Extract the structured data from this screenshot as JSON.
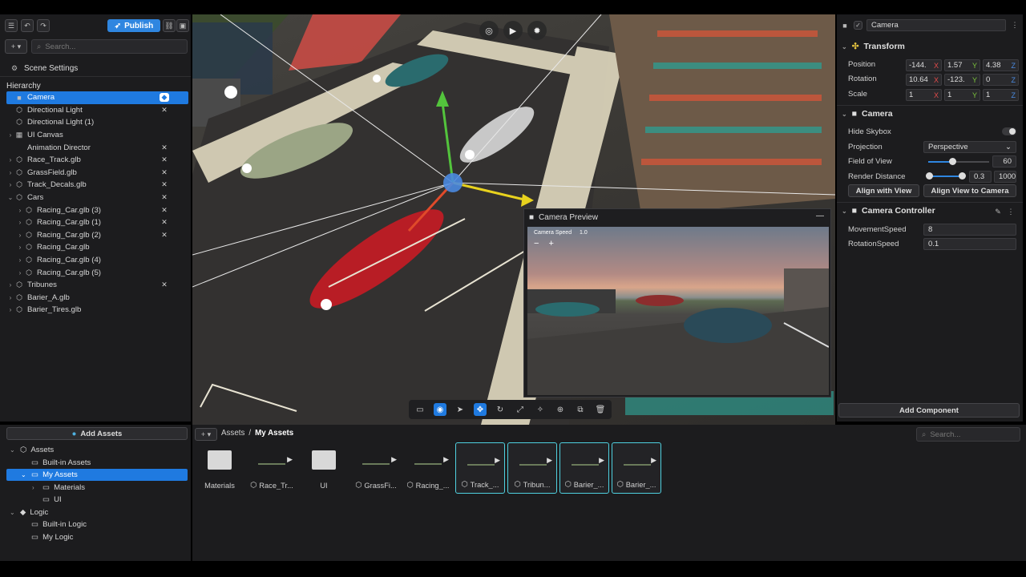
{
  "toolbar": {
    "publish_label": "Publish",
    "search_placeholder": "Search..."
  },
  "scene_settings_label": "Scene Settings",
  "hierarchy": {
    "title": "Hierarchy",
    "items": [
      {
        "label": "Camera",
        "icon": "camera-icon",
        "arrow": "",
        "indent": 0,
        "selected": true,
        "badge": "logic-icon"
      },
      {
        "label": "Directional Light",
        "icon": "cube-icon",
        "arrow": "",
        "indent": 0,
        "badge": "animation-icon"
      },
      {
        "label": "Directional Light (1)",
        "icon": "cube-icon",
        "arrow": "",
        "indent": 0,
        "badge": ""
      },
      {
        "label": "UI Canvas",
        "icon": "grid-icon",
        "arrow": "›",
        "indent": 0,
        "badge": ""
      },
      {
        "label": "Animation Director",
        "icon": "",
        "arrow": "",
        "indent": 0,
        "badge": "animation-icon"
      },
      {
        "label": "Race_Track.glb",
        "icon": "cube-icon",
        "arrow": "›",
        "indent": 0,
        "badge": "animation-icon"
      },
      {
        "label": "GrassField.glb",
        "icon": "cube-icon",
        "arrow": "›",
        "indent": 0,
        "badge": "animation-icon"
      },
      {
        "label": "Track_Decals.glb",
        "icon": "cube-icon",
        "arrow": "›",
        "indent": 0,
        "badge": "animation-icon"
      },
      {
        "label": "Cars",
        "icon": "cube-icon",
        "arrow": "⌄",
        "indent": 0,
        "badge": "animation-icon"
      },
      {
        "label": "Racing_Car.glb (3)",
        "icon": "cube-icon",
        "arrow": "›",
        "indent": 1,
        "badge": "animation-icon"
      },
      {
        "label": "Racing_Car.glb (1)",
        "icon": "cube-icon",
        "arrow": "›",
        "indent": 1,
        "badge": "animation-icon"
      },
      {
        "label": "Racing_Car.glb (2)",
        "icon": "cube-icon",
        "arrow": "›",
        "indent": 1,
        "badge": "animation-icon"
      },
      {
        "label": "Racing_Car.glb",
        "icon": "cube-icon",
        "arrow": "›",
        "indent": 1,
        "badge": ""
      },
      {
        "label": "Racing_Car.glb (4)",
        "icon": "cube-icon",
        "arrow": "›",
        "indent": 1,
        "badge": ""
      },
      {
        "label": "Racing_Car.glb (5)",
        "icon": "cube-icon",
        "arrow": "›",
        "indent": 1,
        "badge": ""
      },
      {
        "label": "Tribunes",
        "icon": "cube-icon",
        "arrow": "›",
        "indent": 0,
        "badge": "animation-icon"
      },
      {
        "label": "Barier_A.glb",
        "icon": "cube-icon",
        "arrow": "›",
        "indent": 0,
        "badge": ""
      },
      {
        "label": "Barier_Tires.glb",
        "icon": "cube-icon",
        "arrow": "›",
        "indent": 0,
        "badge": ""
      }
    ]
  },
  "camera_preview": {
    "title": "Camera Preview",
    "speed_label": "Camera Speed",
    "speed_value": "1.0"
  },
  "inspector": {
    "object_name": "Camera",
    "transform": {
      "title": "Transform",
      "position_label": "Position",
      "position": [
        "-144.",
        "1.57",
        "4.38"
      ],
      "rotation_label": "Rotation",
      "rotation": [
        "10.64",
        "-123.",
        "0"
      ],
      "scale_label": "Scale",
      "scale": [
        "1",
        "1",
        "1"
      ]
    },
    "camera": {
      "title": "Camera",
      "hide_skybox_label": "Hide Skybox",
      "projection_label": "Projection",
      "projection_value": "Perspective",
      "fov_label": "Field of View",
      "fov_value": "60",
      "render_distance_label": "Render Distance",
      "render_near": "0.3",
      "render_far": "1000",
      "align_with_view": "Align with View",
      "align_view_to_camera": "Align View to Camera"
    },
    "controller": {
      "title": "Camera Controller",
      "movement_label": "MovementSpeed",
      "movement_value": "8",
      "rotation_label": "RotationSpeed",
      "rotation_value": "0.1"
    },
    "add_component": "Add Component"
  },
  "assets_panel": {
    "add_assets": "Add Assets",
    "tree": [
      {
        "label": "Assets",
        "arrow": "⌄",
        "indent": 0,
        "icon": "cube-icon"
      },
      {
        "label": "Built-in Assets",
        "arrow": "",
        "indent": 1,
        "icon": "folder-icon"
      },
      {
        "label": "My Assets",
        "arrow": "⌄",
        "indent": 1,
        "icon": "folder-icon",
        "selected": true
      },
      {
        "label": "Materials",
        "arrow": "›",
        "indent": 2,
        "icon": "folder-icon"
      },
      {
        "label": "UI",
        "arrow": "",
        "indent": 2,
        "icon": "folder-icon"
      },
      {
        "label": "Logic",
        "arrow": "⌄",
        "indent": 0,
        "icon": "logic-icon"
      },
      {
        "label": "Built-in Logic",
        "arrow": "",
        "indent": 1,
        "icon": "folder-icon"
      },
      {
        "label": "My Logic",
        "arrow": "",
        "indent": 1,
        "icon": "folder-icon"
      }
    ],
    "breadcrumb": [
      "Assets",
      "My Assets"
    ],
    "search_placeholder": "Search...",
    "tiles": [
      {
        "label": "Materials",
        "kind": "folder",
        "highlight": false
      },
      {
        "label": "Race_Tr...",
        "kind": "model",
        "highlight": false
      },
      {
        "label": "UI",
        "kind": "folder",
        "highlight": false
      },
      {
        "label": "GrassFi...",
        "kind": "model",
        "highlight": false
      },
      {
        "label": "Racing_...",
        "kind": "model",
        "highlight": false
      },
      {
        "label": "Track_...",
        "kind": "model",
        "highlight": true
      },
      {
        "label": "Tribun...",
        "kind": "model",
        "highlight": true
      },
      {
        "label": "Barier_...",
        "kind": "model",
        "highlight": true
      },
      {
        "label": "Barier_...",
        "kind": "model",
        "highlight": true
      }
    ]
  },
  "colors": {
    "accent": "#1f7ae0",
    "publish": "#2f86e0",
    "highlight": "#4fd1e0"
  }
}
